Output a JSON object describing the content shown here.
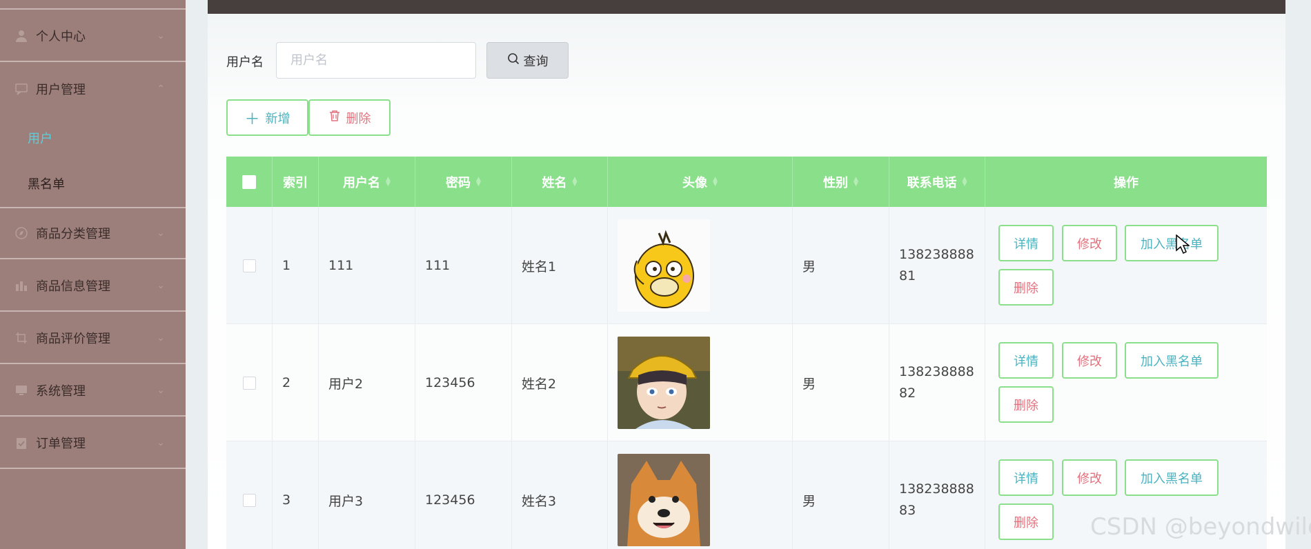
{
  "sidebar": {
    "items": [
      {
        "label": "个人中心",
        "icon": "user-icon"
      },
      {
        "label": "用户管理",
        "icon": "message-icon"
      },
      {
        "label": "商品分类管理",
        "icon": "compass-icon"
      },
      {
        "label": "商品信息管理",
        "icon": "chart-icon"
      },
      {
        "label": "商品评价管理",
        "icon": "crop-icon"
      },
      {
        "label": "系统管理",
        "icon": "monitor-icon"
      },
      {
        "label": "订单管理",
        "icon": "clipboard-icon"
      }
    ],
    "sub_items": [
      {
        "label": "用户",
        "active": true
      },
      {
        "label": "黑名单",
        "active": false
      }
    ]
  },
  "search": {
    "label": "用户名",
    "placeholder": "用户名",
    "value": "",
    "button": "查询"
  },
  "toolbar": {
    "add": "新增",
    "delete": "删除"
  },
  "table": {
    "headers": [
      "索引",
      "用户名",
      "密码",
      "姓名",
      "头像",
      "性别",
      "联系电话",
      "操作"
    ],
    "rows": [
      {
        "index": "1",
        "username": "111",
        "password": "111",
        "name": "姓名1",
        "gender": "男",
        "phone": "13823888881",
        "avatar": "yellow duck cartoon"
      },
      {
        "index": "2",
        "username": "用户2",
        "password": "123456",
        "name": "姓名2",
        "gender": "男",
        "phone": "13823888882",
        "avatar": "anime boy with yellow hat"
      },
      {
        "index": "3",
        "username": "用户3",
        "password": "123456",
        "name": "姓名3",
        "gender": "男",
        "phone": "13823888883",
        "avatar": "shiba dog"
      }
    ],
    "actions": {
      "detail": "详情",
      "edit": "修改",
      "blacklist": "加入黑名单",
      "delete": "删除"
    }
  },
  "colors": {
    "sidebar_bg": "#9c7f7b",
    "header_green": "#8ae08a",
    "accent_teal": "#4bb3c0",
    "danger_red": "#e2717d",
    "topbar": "#463f3d"
  },
  "watermark": "CSDN @beyondwild"
}
